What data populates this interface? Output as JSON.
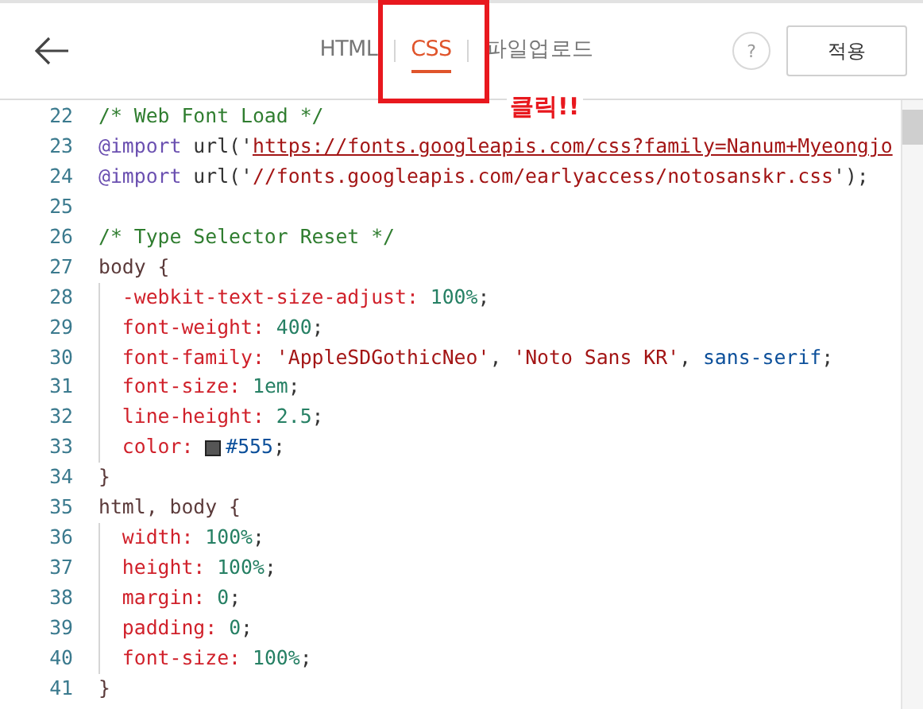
{
  "toolbar": {
    "tabs": [
      {
        "label": "HTML",
        "selected": false
      },
      {
        "label": "CSS",
        "selected": true
      },
      {
        "label": "파일업로드",
        "selected": false
      }
    ],
    "help": "?",
    "apply_button": "적용"
  },
  "annotation": {
    "text": "클릭!!"
  },
  "editor": {
    "lines": [
      {
        "number": "22",
        "guide": false,
        "tokens": [
          {
            "kind": "comment",
            "text": "/* Web Font Load */"
          }
        ]
      },
      {
        "number": "23",
        "guide": false,
        "tokens": [
          {
            "kind": "atrule",
            "text": "@import"
          },
          {
            "kind": "plain",
            "text": " url('"
          },
          {
            "kind": "link",
            "text": "https://fonts.googleapis.com/css?family=Nanum+Myeongjo"
          }
        ]
      },
      {
        "number": "24",
        "guide": false,
        "tokens": [
          {
            "kind": "atrule",
            "text": "@import"
          },
          {
            "kind": "plain",
            "text": " url('"
          },
          {
            "kind": "string",
            "text": "//fonts.googleapis.com/earlyaccess/notosanskr.css"
          },
          {
            "kind": "plain",
            "text": "');"
          }
        ]
      },
      {
        "number": "25",
        "guide": false
      },
      {
        "number": "26",
        "guide": false,
        "tokens": [
          {
            "kind": "comment",
            "text": "/* Type Selector Reset */"
          }
        ]
      },
      {
        "number": "27",
        "guide": false,
        "tokens": [
          {
            "kind": "selector",
            "text": "body {"
          }
        ]
      },
      {
        "number": "28",
        "guide": true,
        "tokens": [
          {
            "kind": "property",
            "text": "  -webkit-text-size-adjust:"
          },
          {
            "kind": "number",
            "text": " 100%"
          },
          {
            "kind": "plain",
            "text": ";"
          }
        ]
      },
      {
        "number": "29",
        "guide": true,
        "tokens": [
          {
            "kind": "property",
            "text": "  font-weight:"
          },
          {
            "kind": "number",
            "text": " 400"
          },
          {
            "kind": "plain",
            "text": ";"
          }
        ]
      },
      {
        "number": "30",
        "guide": true,
        "tokens": [
          {
            "kind": "property",
            "text": "  font-family:"
          },
          {
            "kind": "string",
            "text": " 'AppleSDGothicNeo'"
          },
          {
            "kind": "plain",
            "text": ", "
          },
          {
            "kind": "string",
            "text": "'Noto Sans KR'"
          },
          {
            "kind": "plain",
            "text": ", "
          },
          {
            "kind": "keyword",
            "text": "sans-serif"
          },
          {
            "kind": "plain",
            "text": ";"
          }
        ]
      },
      {
        "number": "31",
        "guide": true,
        "tokens": [
          {
            "kind": "property",
            "text": "  font-size:"
          },
          {
            "kind": "number",
            "text": " 1em"
          },
          {
            "kind": "plain",
            "text": ";"
          }
        ]
      },
      {
        "number": "32",
        "guide": true,
        "tokens": [
          {
            "kind": "property",
            "text": "  line-height:"
          },
          {
            "kind": "number",
            "text": " 2.5"
          },
          {
            "kind": "plain",
            "text": ";"
          }
        ]
      },
      {
        "number": "33",
        "guide": true,
        "tokens": [
          {
            "kind": "property",
            "text": "  color: "
          },
          {
            "kind": "swatch",
            "color": "#555555"
          },
          {
            "kind": "keyword",
            "text": "#555"
          },
          {
            "kind": "plain",
            "text": ";"
          }
        ]
      },
      {
        "number": "34",
        "guide": false,
        "tokens": [
          {
            "kind": "selector",
            "text": "}"
          }
        ]
      },
      {
        "number": "35",
        "guide": false,
        "tokens": [
          {
            "kind": "selector",
            "text": "html, body {"
          }
        ]
      },
      {
        "number": "36",
        "guide": true,
        "tokens": [
          {
            "kind": "property",
            "text": "  width:"
          },
          {
            "kind": "number",
            "text": " 100%"
          },
          {
            "kind": "plain",
            "text": ";"
          }
        ]
      },
      {
        "number": "37",
        "guide": true,
        "tokens": [
          {
            "kind": "property",
            "text": "  height:"
          },
          {
            "kind": "number",
            "text": " 100%"
          },
          {
            "kind": "plain",
            "text": ";"
          }
        ]
      },
      {
        "number": "38",
        "guide": true,
        "tokens": [
          {
            "kind": "property",
            "text": "  margin:"
          },
          {
            "kind": "number",
            "text": " 0"
          },
          {
            "kind": "plain",
            "text": ";"
          }
        ]
      },
      {
        "number": "39",
        "guide": true,
        "tokens": [
          {
            "kind": "property",
            "text": "  padding:"
          },
          {
            "kind": "number",
            "text": " 0"
          },
          {
            "kind": "plain",
            "text": ";"
          }
        ]
      },
      {
        "number": "40",
        "guide": true,
        "tokens": [
          {
            "kind": "property",
            "text": "  font-size:"
          },
          {
            "kind": "number",
            "text": " 100%"
          },
          {
            "kind": "plain",
            "text": ";"
          }
        ]
      },
      {
        "number": "41",
        "guide": false,
        "tokens": [
          {
            "kind": "selector",
            "text": "}"
          }
        ]
      }
    ]
  }
}
